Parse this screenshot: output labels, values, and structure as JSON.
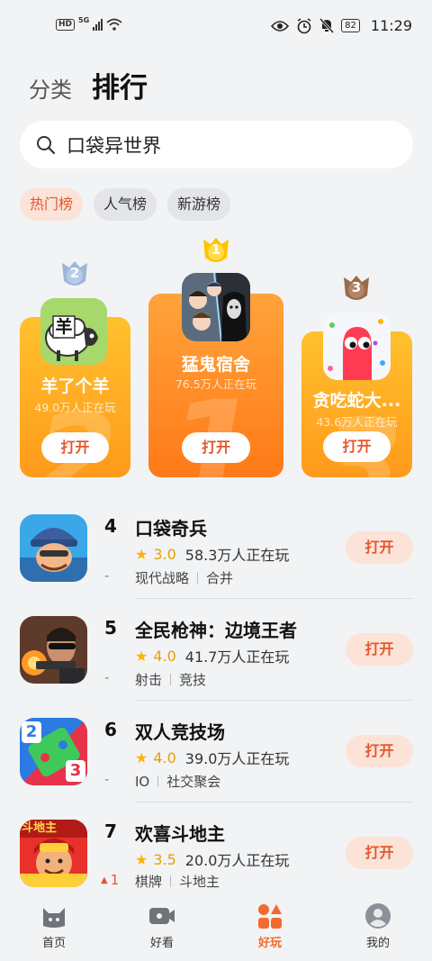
{
  "status_bar": {
    "hd": "HD",
    "network": "5G",
    "battery": "82",
    "time": "11:29"
  },
  "header": {
    "tab_category": "分类",
    "tab_ranking": "排行"
  },
  "search": {
    "value": "口袋异世界"
  },
  "chips": [
    {
      "label": "热门榜",
      "active": true
    },
    {
      "label": "人气榜",
      "active": false
    },
    {
      "label": "新游榜",
      "active": false
    }
  ],
  "podium": [
    {
      "rank": "1",
      "name": "猛鬼宿舍",
      "players": "76.5万人正在玩",
      "button": "打开"
    },
    {
      "rank": "2",
      "name": "羊了个羊",
      "players": "49.0万人正在玩",
      "button": "打开",
      "icon_text": "羊"
    },
    {
      "rank": "3",
      "name": "贪吃蛇大...",
      "players": "43.6万人正在玩",
      "button": "打开"
    }
  ],
  "list": [
    {
      "rank": "4",
      "name": "口袋奇兵",
      "rating": "3.0",
      "players": "58.3万人正在玩",
      "tags": [
        "现代战略",
        "合并"
      ],
      "change": "-",
      "button": "打开"
    },
    {
      "rank": "5",
      "name": "全民枪神：边境王者",
      "rating": "4.0",
      "players": "41.7万人正在玩",
      "tags": [
        "射击",
        "竞技"
      ],
      "change": "-",
      "button": "打开"
    },
    {
      "rank": "6",
      "name": "双人竞技场",
      "rating": "4.0",
      "players": "39.0万人正在玩",
      "tags": [
        "IO",
        "社交聚会"
      ],
      "change": "-",
      "button": "打开",
      "icon_labels": [
        "2",
        "3"
      ]
    },
    {
      "rank": "7",
      "name": "欢喜斗地主",
      "rating": "3.5",
      "players": "20.0万人正在玩",
      "tags": [
        "棋牌",
        "斗地主"
      ],
      "change": "1",
      "button": "打开",
      "icon_text": "斗地主"
    }
  ],
  "bottom_nav": [
    {
      "label": "首页",
      "icon": "home-icon",
      "active": false
    },
    {
      "label": "好看",
      "icon": "video-icon",
      "active": false
    },
    {
      "label": "好玩",
      "icon": "games-icon",
      "active": true
    },
    {
      "label": "我的",
      "icon": "profile-icon",
      "active": false
    }
  ],
  "colors": {
    "accent": "#e4572e",
    "podium_gold": "#ffb12a",
    "podium_orange": "#ff7a18",
    "star": "#ffb200",
    "background": "#f1f3f5"
  }
}
